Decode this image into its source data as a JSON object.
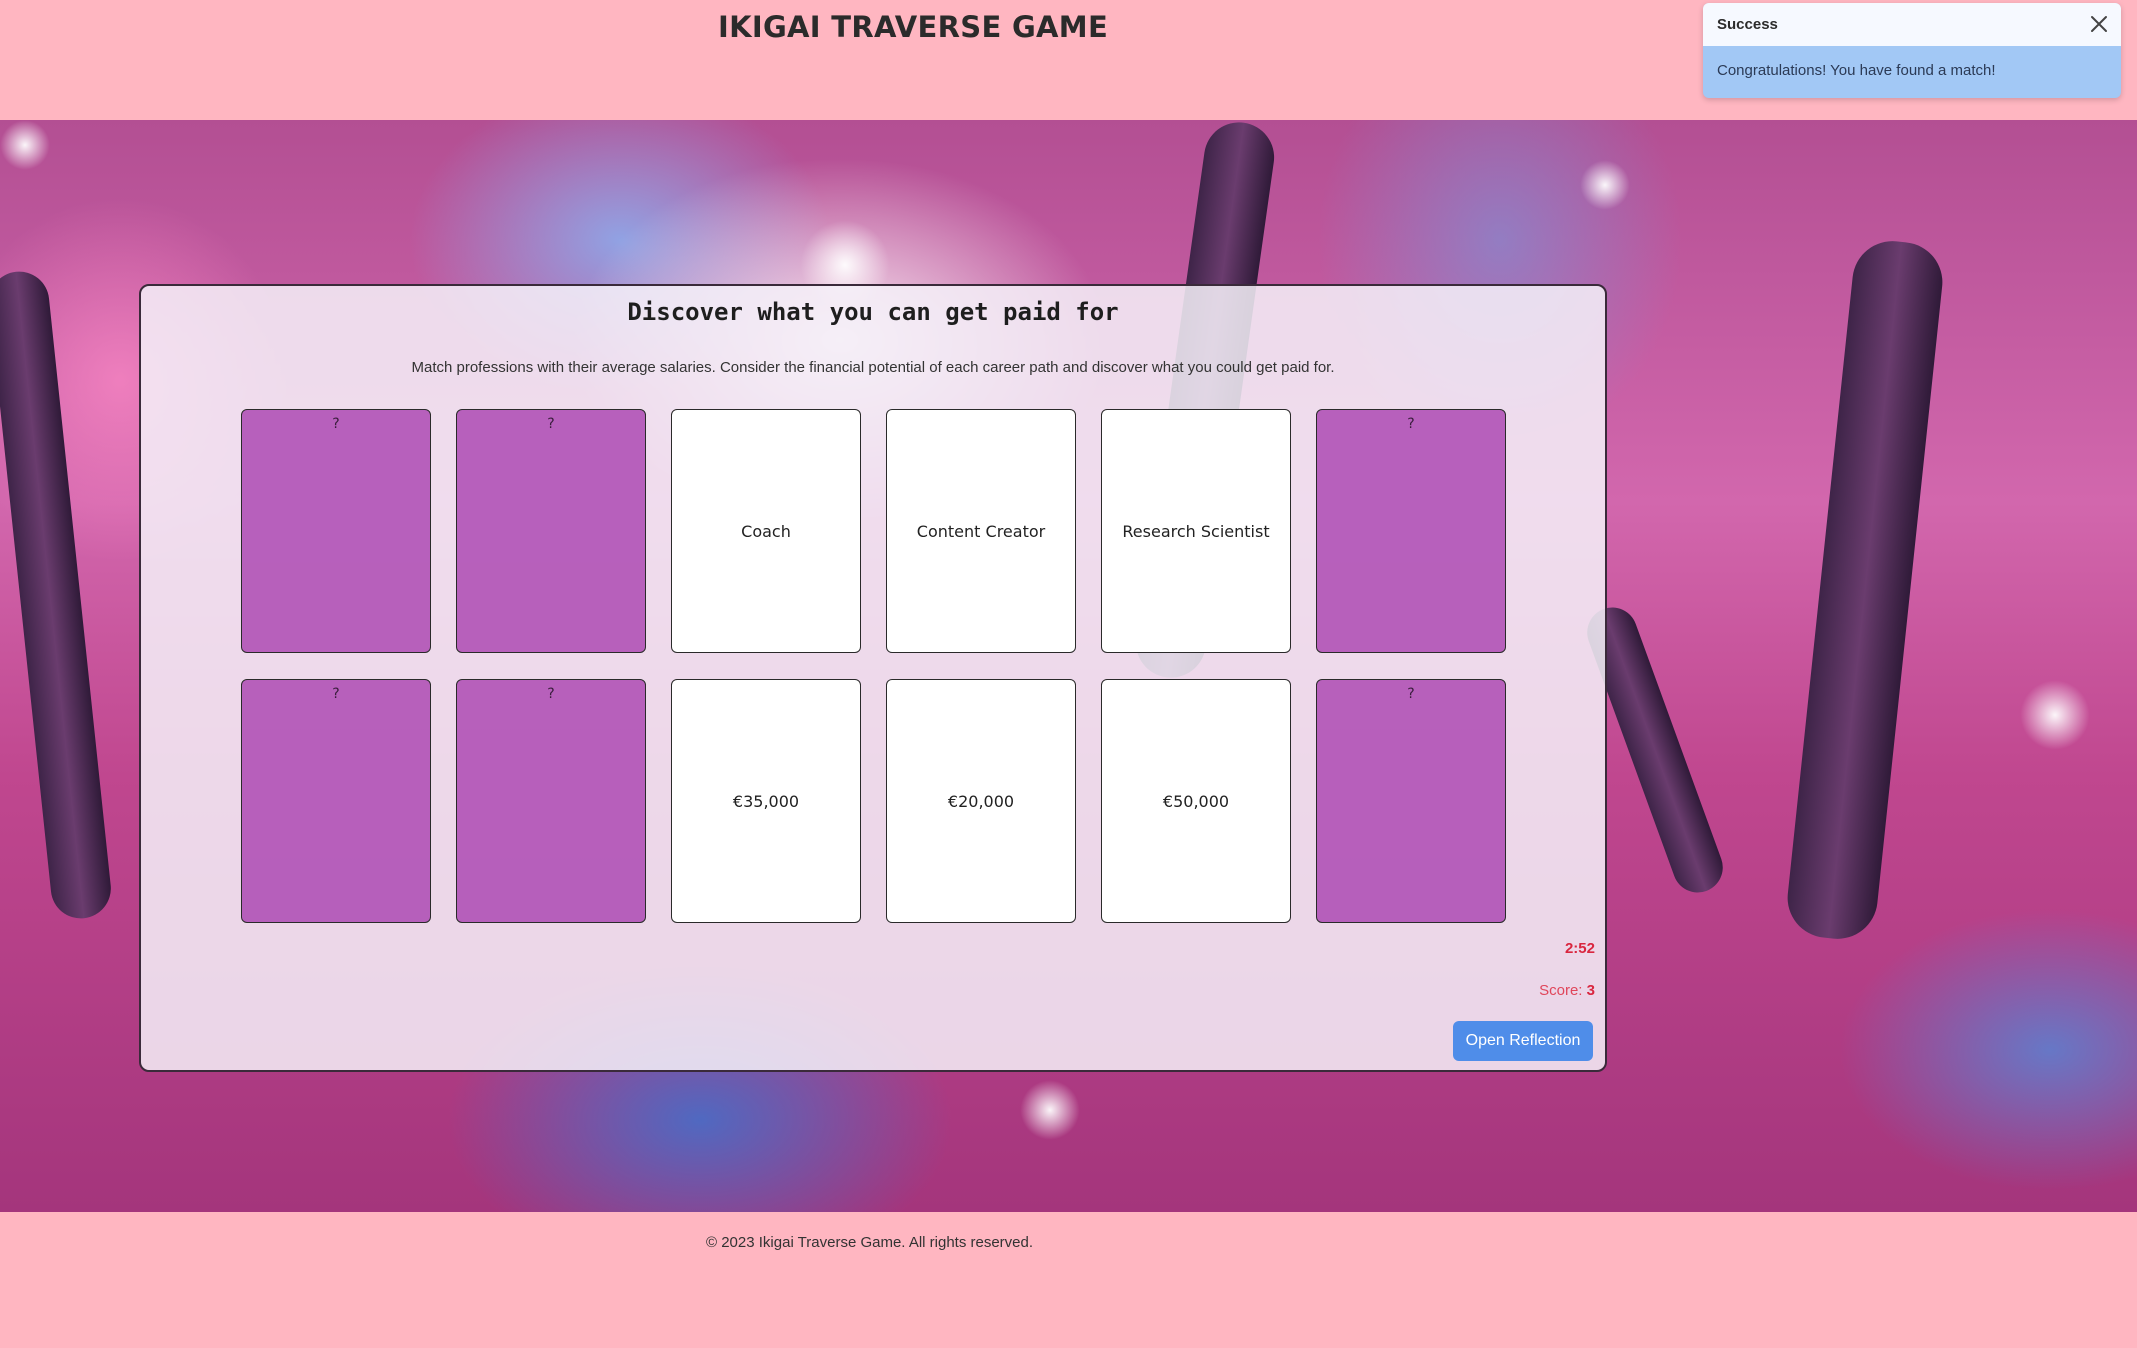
{
  "header": {
    "title": "IKIGAI TRAVERSE GAME"
  },
  "panel": {
    "title": "Discover what you can get paid for",
    "description": "Match professions with their average salaries. Consider the financial potential of each career path and discover what you could get paid for."
  },
  "cards": {
    "row1": [
      {
        "face": "down",
        "label": "?"
      },
      {
        "face": "down",
        "label": "?"
      },
      {
        "face": "up",
        "label": "Coach"
      },
      {
        "face": "up",
        "label": "Content Creator"
      },
      {
        "face": "up",
        "label": "Research Scientist"
      },
      {
        "face": "down",
        "label": "?"
      }
    ],
    "row2": [
      {
        "face": "down",
        "label": "?"
      },
      {
        "face": "down",
        "label": "?"
      },
      {
        "face": "up",
        "label": "€35,000"
      },
      {
        "face": "up",
        "label": "€20,000"
      },
      {
        "face": "up",
        "label": "€50,000"
      },
      {
        "face": "down",
        "label": "?"
      }
    ]
  },
  "status": {
    "timer": "2:52",
    "score_label": "Score:",
    "score_value": "3"
  },
  "buttons": {
    "reflection": "Open Reflection"
  },
  "footer": {
    "text": "© 2023 Ikigai Traverse Game. All rights reserved."
  },
  "toast": {
    "title": "Success",
    "message": "Congratulations! You have found a match!"
  },
  "colors": {
    "page_bg": "#ffb6c1",
    "card_back": "#b052b6",
    "button": "#4f8de9",
    "score": "#d9263f"
  }
}
